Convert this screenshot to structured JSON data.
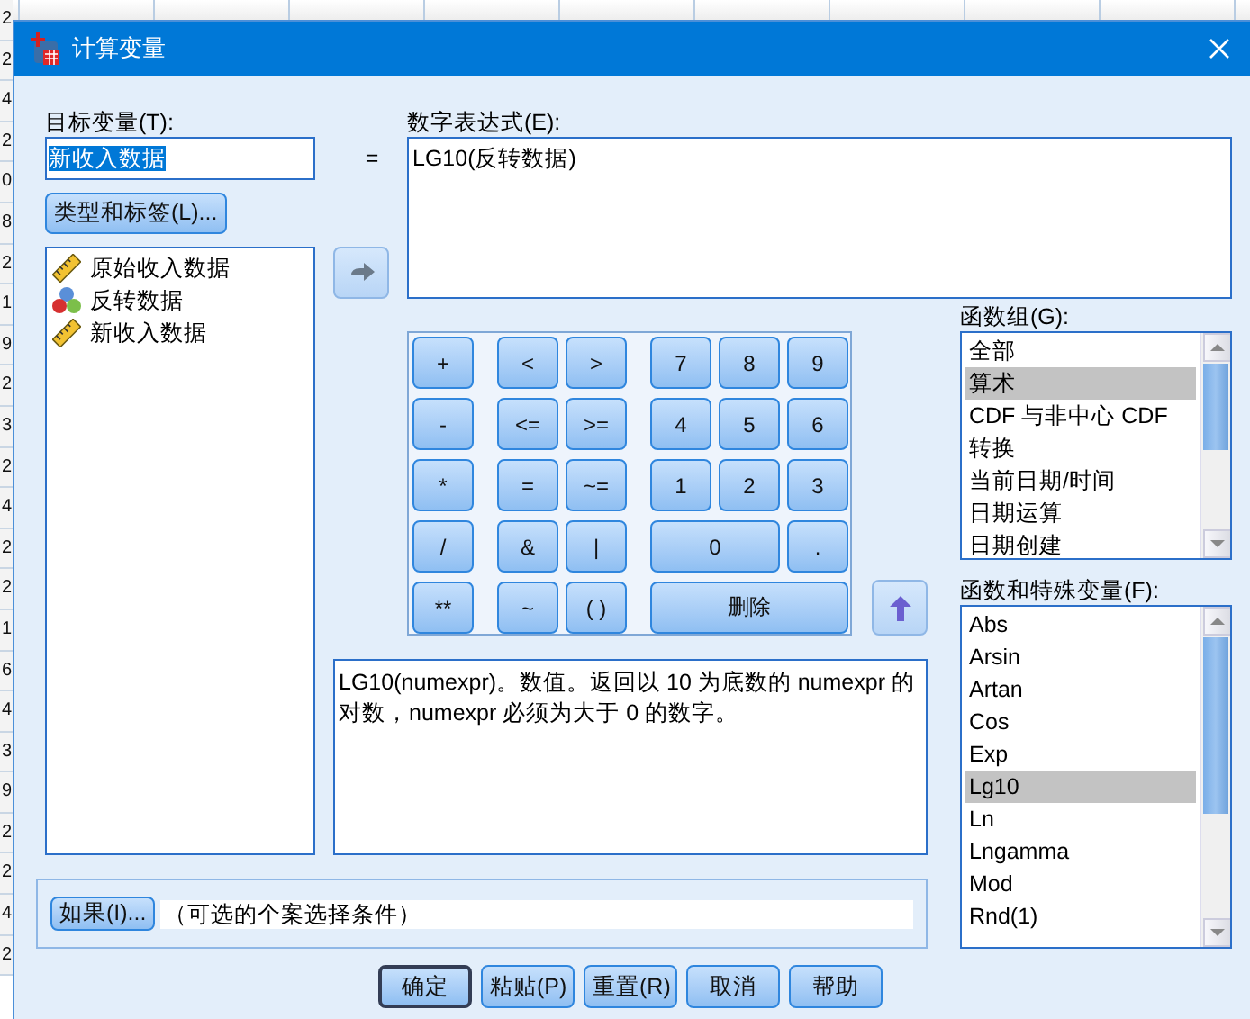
{
  "background": {
    "row_numbers": [
      "2",
      "2",
      "4",
      "2",
      "0",
      "8",
      "2",
      "1",
      "9",
      "2",
      "3",
      "2",
      "4",
      "2",
      "2",
      "1",
      "6",
      "4",
      "3",
      "9",
      "2",
      "2",
      "4",
      "2"
    ]
  },
  "window": {
    "title": "计算变量"
  },
  "target": {
    "label": "目标变量(T):",
    "value": "新收入数据",
    "value_selected": true
  },
  "equals": "=",
  "type_button": "类型和标签(L)...",
  "variables": [
    {
      "name": "原始收入数据",
      "kind": "scale"
    },
    {
      "name": "反转数据",
      "kind": "nominal"
    },
    {
      "name": "新收入数据",
      "kind": "scale"
    }
  ],
  "expression": {
    "label": "数字表达式(E):",
    "value": "LG10(反转数据)"
  },
  "keypad": [
    [
      {
        "label": "+",
        "kind": "single"
      },
      {
        "label": "<",
        "kind": "single"
      },
      {
        "label": ">",
        "kind": "single"
      },
      {
        "label": "7",
        "kind": "single"
      },
      {
        "label": "8",
        "kind": "single"
      },
      {
        "label": "9",
        "kind": "single"
      }
    ],
    [
      {
        "label": "-",
        "kind": "single"
      },
      {
        "label": "<=",
        "kind": "single"
      },
      {
        "label": ">=",
        "kind": "single"
      },
      {
        "label": "4",
        "kind": "single"
      },
      {
        "label": "5",
        "kind": "single"
      },
      {
        "label": "6",
        "kind": "single"
      }
    ],
    [
      {
        "label": "*",
        "kind": "single"
      },
      {
        "label": "=",
        "kind": "single"
      },
      {
        "label": "~=",
        "kind": "single"
      },
      {
        "label": "1",
        "kind": "single"
      },
      {
        "label": "2",
        "kind": "single"
      },
      {
        "label": "3",
        "kind": "single"
      }
    ],
    [
      {
        "label": "/",
        "kind": "single"
      },
      {
        "label": "&",
        "kind": "single"
      },
      {
        "label": "|",
        "kind": "single"
      },
      {
        "label": "0",
        "kind": "double"
      },
      {
        "label": ".",
        "kind": "single"
      }
    ],
    [
      {
        "label": "**",
        "kind": "single"
      },
      {
        "label": "~",
        "kind": "single"
      },
      {
        "label": "( )",
        "kind": "single"
      },
      {
        "label": "删除",
        "kind": "triple"
      }
    ]
  ],
  "function_groups": {
    "label": "函数组(G):",
    "items": [
      {
        "label": "全部",
        "selected": false
      },
      {
        "label": "算术",
        "selected": true
      },
      {
        "label": "CDF 与非中心 CDF",
        "selected": false
      },
      {
        "label": "转换",
        "selected": false
      },
      {
        "label": "当前日期/时间",
        "selected": false
      },
      {
        "label": "日期运算",
        "selected": false
      },
      {
        "label": "日期创建",
        "selected": false
      }
    ]
  },
  "functions": {
    "label": "函数和特殊变量(F):",
    "items": [
      {
        "label": "Abs",
        "selected": false
      },
      {
        "label": "Arsin",
        "selected": false
      },
      {
        "label": "Artan",
        "selected": false
      },
      {
        "label": "Cos",
        "selected": false
      },
      {
        "label": "Exp",
        "selected": false
      },
      {
        "label": "Lg10",
        "selected": true
      },
      {
        "label": "Ln",
        "selected": false
      },
      {
        "label": "Lngamma",
        "selected": false
      },
      {
        "label": "Mod",
        "selected": false
      },
      {
        "label": "Rnd(1)",
        "selected": false
      }
    ]
  },
  "description": "LG10(numexpr)。数值。返回以 10 为底数的 numexpr 的对数，numexpr 必须为大于 0 的数字。",
  "condition": {
    "button": "如果(I)...",
    "text": "（可选的个案选择条件）"
  },
  "buttons": [
    {
      "label": "确定",
      "default": true
    },
    {
      "label": "粘贴(P)",
      "default": false
    },
    {
      "label": "重置(R)",
      "default": false
    },
    {
      "label": "取消",
      "default": false
    },
    {
      "label": "帮助",
      "default": false
    }
  ]
}
